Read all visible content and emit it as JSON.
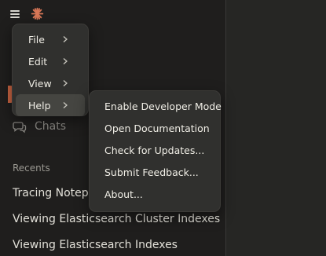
{
  "menu": {
    "items": [
      {
        "label": "File"
      },
      {
        "label": "Edit"
      },
      {
        "label": "View"
      },
      {
        "label": "Help"
      }
    ],
    "active_item": "Help"
  },
  "help_submenu": {
    "items": [
      {
        "label": "Enable Developer Mode"
      },
      {
        "label": "Open Documentation"
      },
      {
        "label": "Check for Updates..."
      },
      {
        "label": "Submit Feedback..."
      },
      {
        "label": "About..."
      }
    ]
  },
  "sidebar": {
    "chats_label": "Chats",
    "recents_heading": "Recents",
    "recents": [
      {
        "title": "Tracing Notepad"
      },
      {
        "title": "Viewing Elasticsearch Cluster Indexes"
      },
      {
        "title": "Viewing Elasticsearch Indexes"
      }
    ]
  },
  "colors": {
    "accent": "#c96442",
    "menu_background": "#30302e",
    "sidebar_background": "#1f1e1d"
  }
}
